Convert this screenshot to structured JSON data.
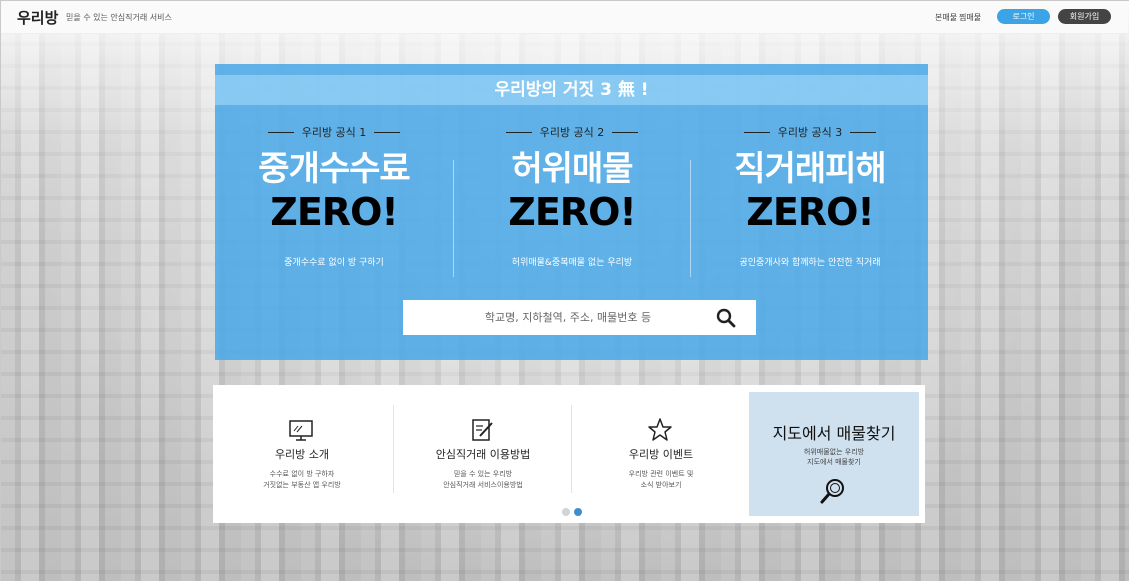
{
  "header": {
    "logo": "우리방",
    "tagline": "믿을 수 있는 안심직거래 서비스",
    "nav": [
      "본매물",
      "찜매물"
    ],
    "login_label": "로그인",
    "join_label": "회원가입"
  },
  "hero": {
    "banner": "우리방의 거짓 3 無 !",
    "columns": [
      {
        "formula": "우리방 공식 1",
        "headline": "중개수수료",
        "zero": "ZERO!",
        "desc": "중개수수료 없이 방 구하기"
      },
      {
        "formula": "우리방 공식 2",
        "headline": "허위매물",
        "zero": "ZERO!",
        "desc": "허위매물&중복매물 없는 우리방"
      },
      {
        "formula": "우리방 공식 3",
        "headline": "직거래피해",
        "zero": "ZERO!",
        "desc": "공인중개사와 함께하는 안전한 직거래"
      }
    ],
    "search": {
      "placeholder": "학교명, 지하철역, 주소, 매물번호 등",
      "icon": "search-icon"
    }
  },
  "panel": {
    "cards": [
      {
        "icon": "monitor-icon",
        "title": "우리방 소개",
        "line1": "수수료 없이 방 구하자",
        "line2": "거짓없는 부동산 앱 우리방"
      },
      {
        "icon": "edit-document-icon",
        "title": "안심직거래 이용방법",
        "line1": "믿을 수 있는 우리방",
        "line2": "안심직거래 서비스이용방법"
      },
      {
        "icon": "star-icon",
        "title": "우리방 이벤트",
        "line1": "우리방 관련 이벤트 및",
        "line2": "소식 받아보기"
      }
    ],
    "map_card": {
      "title": "지도에서 매물찾기",
      "line1": "허위매물없는 우리방",
      "line2": "지도에서 매물찾기",
      "icon": "magnifier-icon"
    },
    "pagination": {
      "count": 2,
      "active": 2
    }
  },
  "colors": {
    "accent": "#3ba3e6",
    "hero": "#48a8e8",
    "dark_button": "#444444",
    "map_card": "#cfe0ee"
  }
}
